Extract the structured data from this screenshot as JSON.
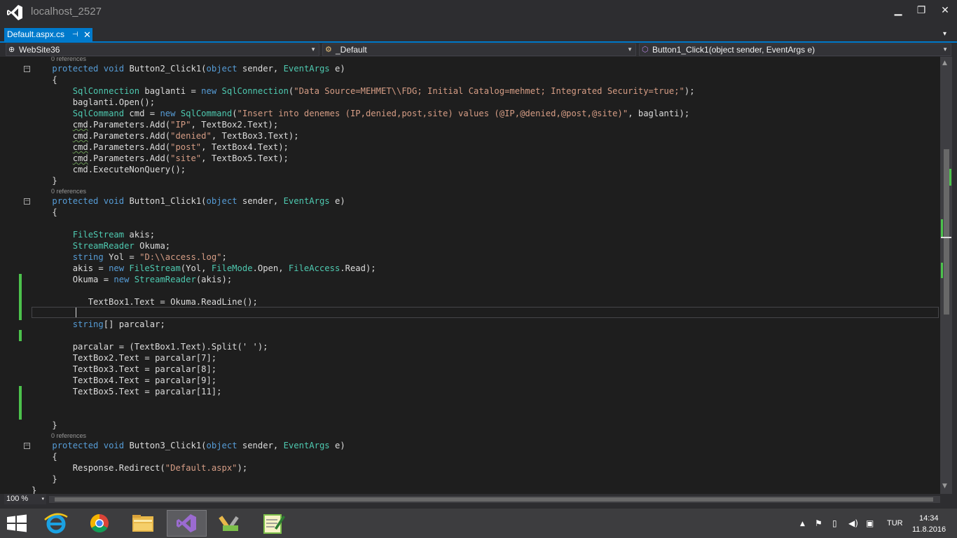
{
  "window": {
    "title": "localhost_2527",
    "controls": {
      "minimize": "▁",
      "restore": "❐",
      "close": "✕"
    }
  },
  "tabs": [
    {
      "label": "Default.aspx.cs",
      "pin": "⊣",
      "close": "✕",
      "active": true
    }
  ],
  "tab_overflow": "▾",
  "navigation": {
    "project": "WebSite36",
    "class": "_Default",
    "member": "Button1_Click1(object sender, EventArgs e)",
    "split_glyph": "+"
  },
  "editor": {
    "codelens": [
      "0 references",
      "0 references",
      "0 references"
    ],
    "fold_glyph": "−",
    "code_lines": [
      "    protected void Button2_Click1(object sender, EventArgs e)",
      "    {",
      "        SqlConnection baglanti = new SqlConnection(\"Data Source=MEHMET\\\\FDG; Initial Catalog=mehmet; Integrated Security=true;\");",
      "        baglanti.Open();",
      "        SqlCommand cmd = new SqlCommand(\"Insert into denemes (IP,denied,post,site) values (@IP,@denied,@post,@site)\", baglanti);",
      "        cmd.Parameters.Add(\"IP\", TextBox2.Text);",
      "        cmd.Parameters.Add(\"denied\", TextBox3.Text);",
      "        cmd.Parameters.Add(\"post\", TextBox4.Text);",
      "        cmd.Parameters.Add(\"site\", TextBox5.Text);",
      "        cmd.ExecuteNonQuery();",
      "    }",
      "    protected void Button1_Click1(object sender, EventArgs e)",
      "    {",
      "",
      "        FileStream akis;",
      "        StreamReader Okuma;",
      "        string Yol = \"D:\\\\access.log\";",
      "        akis = new FileStream(Yol, FileMode.Open, FileAccess.Read);",
      "        Okuma = new StreamReader(akis);",
      "",
      "           TextBox1.Text = Okuma.ReadLine();",
      "",
      "        string[] parcalar;",
      "",
      "        parcalar = (TextBox1.Text).Split(' ');",
      "        TextBox2.Text = parcalar[7];",
      "        TextBox3.Text = parcalar[8];",
      "        TextBox4.Text = parcalar[9];",
      "        TextBox5.Text = parcalar[11];",
      "",
      "",
      "    }",
      "    protected void Button3_Click1(object sender, EventArgs e)",
      "    {",
      "        Response.Redirect(\"Default.aspx\");",
      "    }",
      "}"
    ],
    "colors": {
      "keyword": "#569cd6",
      "type": "#4ec9b0",
      "string": "#d69d85",
      "text": "#dcdcdc",
      "changed_marker": "#4cc24c"
    }
  },
  "scrollbar": {
    "up": "▲",
    "down": "▼"
  },
  "zoom": {
    "value": "100 %",
    "arrow": "▾"
  },
  "taskbar": {
    "apps": [
      {
        "name": "internet-explorer-icon"
      },
      {
        "name": "chrome-icon"
      },
      {
        "name": "file-explorer-icon"
      },
      {
        "name": "visual-studio-icon",
        "active": true
      },
      {
        "name": "tools-app-icon"
      },
      {
        "name": "notepad-app-icon"
      }
    ],
    "tray": {
      "show_hidden": "▲",
      "language": "TUR",
      "time": "14:34",
      "date": "11.8.2016"
    }
  }
}
